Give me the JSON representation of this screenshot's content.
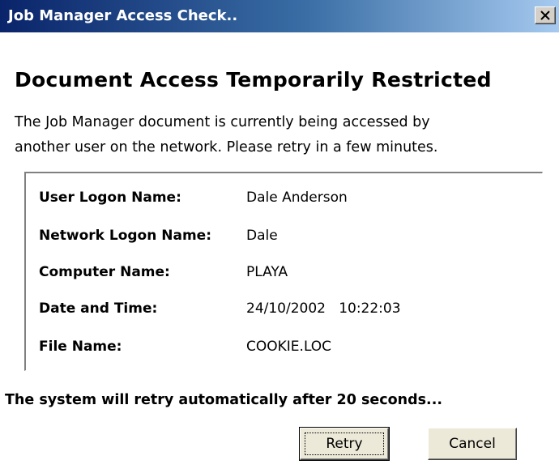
{
  "window": {
    "title": "Job Manager Access Check..",
    "close_icon": "close-icon"
  },
  "heading": "Document Access Temporarily Restricted",
  "message": {
    "line1": "The Job Manager document is currently being accessed by",
    "line2": "another user on the network. Please retry in a few minutes."
  },
  "details": [
    {
      "label": "User Logon Name:",
      "value": "Dale Anderson"
    },
    {
      "label": "Network Logon Name:",
      "value": "Dale"
    },
    {
      "label": "Computer Name:",
      "value": "PLAYA"
    },
    {
      "label": "Date and Time:",
      "value": "24/10/2002   10:22:03"
    },
    {
      "label": "File Name:",
      "value": "COOKIE.LOC"
    }
  ],
  "retry_note": "The system will retry automatically after 20 seconds...",
  "buttons": {
    "retry": "Retry",
    "cancel": "Cancel"
  },
  "colors": {
    "titlebar_start": "#0a246a",
    "titlebar_end": "#a6caf0",
    "button_face": "#ece9d8"
  }
}
